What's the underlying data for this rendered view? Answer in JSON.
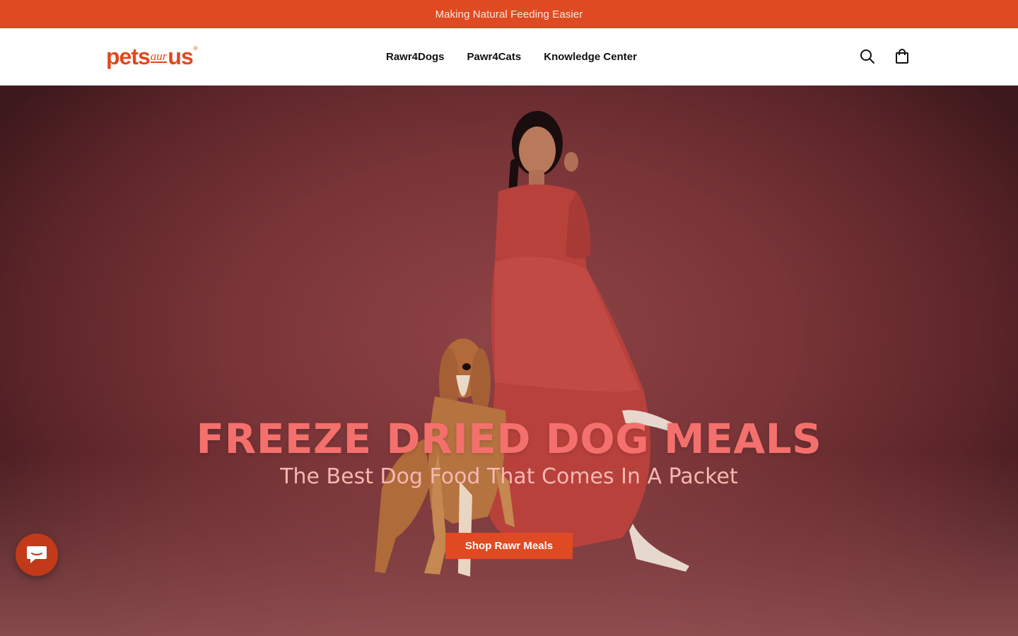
{
  "announcement": {
    "text": "Making Natural Feeding Easier"
  },
  "header": {
    "logo": {
      "part1": "pets",
      "part2": "aur",
      "part3": "us",
      "mark": "®"
    },
    "nav": [
      {
        "label": "Rawr4Dogs"
      },
      {
        "label": "Pawr4Cats"
      },
      {
        "label": "Knowledge Center"
      }
    ],
    "icons": {
      "search": "search-icon",
      "cart": "shopping-bag-icon"
    }
  },
  "hero": {
    "title": "FREEZE DRIED DOG MEALS",
    "subtitle": "The Best Dog Food That Comes In A Packet",
    "cta_label": "Shop Rawr Meals",
    "image_subject": "woman in red dress with afghan hound"
  },
  "chat_widget": {
    "icon": "chat-bubble-icon"
  },
  "colors": {
    "brand_orange": "#e04a22",
    "hero_bg": "#7a3538",
    "title_coral": "#f4706c",
    "subtitle_pink": "#f7b7b0"
  }
}
